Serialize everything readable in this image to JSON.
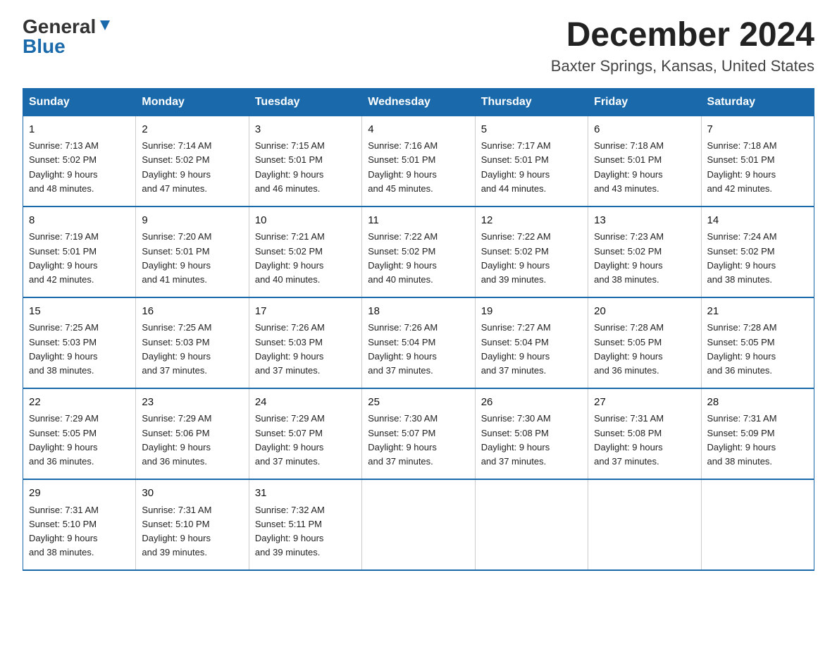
{
  "header": {
    "logo_general": "General",
    "logo_blue": "Blue",
    "month_title": "December 2024",
    "location": "Baxter Springs, Kansas, United States"
  },
  "weekdays": [
    "Sunday",
    "Monday",
    "Tuesday",
    "Wednesday",
    "Thursday",
    "Friday",
    "Saturday"
  ],
  "weeks": [
    [
      {
        "day": "1",
        "sunrise": "7:13 AM",
        "sunset": "5:02 PM",
        "daylight": "9 hours and 48 minutes."
      },
      {
        "day": "2",
        "sunrise": "7:14 AM",
        "sunset": "5:02 PM",
        "daylight": "9 hours and 47 minutes."
      },
      {
        "day": "3",
        "sunrise": "7:15 AM",
        "sunset": "5:01 PM",
        "daylight": "9 hours and 46 minutes."
      },
      {
        "day": "4",
        "sunrise": "7:16 AM",
        "sunset": "5:01 PM",
        "daylight": "9 hours and 45 minutes."
      },
      {
        "day": "5",
        "sunrise": "7:17 AM",
        "sunset": "5:01 PM",
        "daylight": "9 hours and 44 minutes."
      },
      {
        "day": "6",
        "sunrise": "7:18 AM",
        "sunset": "5:01 PM",
        "daylight": "9 hours and 43 minutes."
      },
      {
        "day": "7",
        "sunrise": "7:18 AM",
        "sunset": "5:01 PM",
        "daylight": "9 hours and 42 minutes."
      }
    ],
    [
      {
        "day": "8",
        "sunrise": "7:19 AM",
        "sunset": "5:01 PM",
        "daylight": "9 hours and 42 minutes."
      },
      {
        "day": "9",
        "sunrise": "7:20 AM",
        "sunset": "5:01 PM",
        "daylight": "9 hours and 41 minutes."
      },
      {
        "day": "10",
        "sunrise": "7:21 AM",
        "sunset": "5:02 PM",
        "daylight": "9 hours and 40 minutes."
      },
      {
        "day": "11",
        "sunrise": "7:22 AM",
        "sunset": "5:02 PM",
        "daylight": "9 hours and 40 minutes."
      },
      {
        "day": "12",
        "sunrise": "7:22 AM",
        "sunset": "5:02 PM",
        "daylight": "9 hours and 39 minutes."
      },
      {
        "day": "13",
        "sunrise": "7:23 AM",
        "sunset": "5:02 PM",
        "daylight": "9 hours and 38 minutes."
      },
      {
        "day": "14",
        "sunrise": "7:24 AM",
        "sunset": "5:02 PM",
        "daylight": "9 hours and 38 minutes."
      }
    ],
    [
      {
        "day": "15",
        "sunrise": "7:25 AM",
        "sunset": "5:03 PM",
        "daylight": "9 hours and 38 minutes."
      },
      {
        "day": "16",
        "sunrise": "7:25 AM",
        "sunset": "5:03 PM",
        "daylight": "9 hours and 37 minutes."
      },
      {
        "day": "17",
        "sunrise": "7:26 AM",
        "sunset": "5:03 PM",
        "daylight": "9 hours and 37 minutes."
      },
      {
        "day": "18",
        "sunrise": "7:26 AM",
        "sunset": "5:04 PM",
        "daylight": "9 hours and 37 minutes."
      },
      {
        "day": "19",
        "sunrise": "7:27 AM",
        "sunset": "5:04 PM",
        "daylight": "9 hours and 37 minutes."
      },
      {
        "day": "20",
        "sunrise": "7:28 AM",
        "sunset": "5:05 PM",
        "daylight": "9 hours and 36 minutes."
      },
      {
        "day": "21",
        "sunrise": "7:28 AM",
        "sunset": "5:05 PM",
        "daylight": "9 hours and 36 minutes."
      }
    ],
    [
      {
        "day": "22",
        "sunrise": "7:29 AM",
        "sunset": "5:05 PM",
        "daylight": "9 hours and 36 minutes."
      },
      {
        "day": "23",
        "sunrise": "7:29 AM",
        "sunset": "5:06 PM",
        "daylight": "9 hours and 36 minutes."
      },
      {
        "day": "24",
        "sunrise": "7:29 AM",
        "sunset": "5:07 PM",
        "daylight": "9 hours and 37 minutes."
      },
      {
        "day": "25",
        "sunrise": "7:30 AM",
        "sunset": "5:07 PM",
        "daylight": "9 hours and 37 minutes."
      },
      {
        "day": "26",
        "sunrise": "7:30 AM",
        "sunset": "5:08 PM",
        "daylight": "9 hours and 37 minutes."
      },
      {
        "day": "27",
        "sunrise": "7:31 AM",
        "sunset": "5:08 PM",
        "daylight": "9 hours and 37 minutes."
      },
      {
        "day": "28",
        "sunrise": "7:31 AM",
        "sunset": "5:09 PM",
        "daylight": "9 hours and 38 minutes."
      }
    ],
    [
      {
        "day": "29",
        "sunrise": "7:31 AM",
        "sunset": "5:10 PM",
        "daylight": "9 hours and 38 minutes."
      },
      {
        "day": "30",
        "sunrise": "7:31 AM",
        "sunset": "5:10 PM",
        "daylight": "9 hours and 39 minutes."
      },
      {
        "day": "31",
        "sunrise": "7:32 AM",
        "sunset": "5:11 PM",
        "daylight": "9 hours and 39 minutes."
      },
      null,
      null,
      null,
      null
    ]
  ]
}
